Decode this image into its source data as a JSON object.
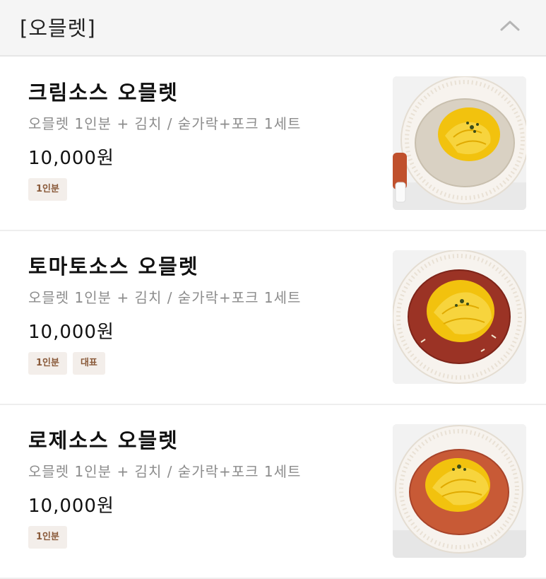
{
  "header": {
    "title": "[오믈렛]",
    "collapse_icon": "chevron-up-icon"
  },
  "items": [
    {
      "title": "크림소스 오믈렛",
      "description": "오믈렛 1인분 + 김치 / 숟가락+포크 1세트",
      "price": "10,000원",
      "badges": [
        "1인분"
      ],
      "sauce_color": "#d9d1c3",
      "sauce_edge": "#c8bfae"
    },
    {
      "title": "토마토소스 오믈렛",
      "description": "오믈렛 1인분 + 김치 / 숟가락+포크 1세트",
      "price": "10,000원",
      "badges": [
        "1인분",
        "대표"
      ],
      "sauce_color": "#9b3325",
      "sauce_edge": "#7e2419"
    },
    {
      "title": "로제소스 오믈렛",
      "description": "오믈렛 1인분 + 김치 / 숟가락+포크 1세트",
      "price": "10,000원",
      "badges": [
        "1인분"
      ],
      "sauce_color": "#c85a36",
      "sauce_edge": "#a8442a"
    }
  ]
}
